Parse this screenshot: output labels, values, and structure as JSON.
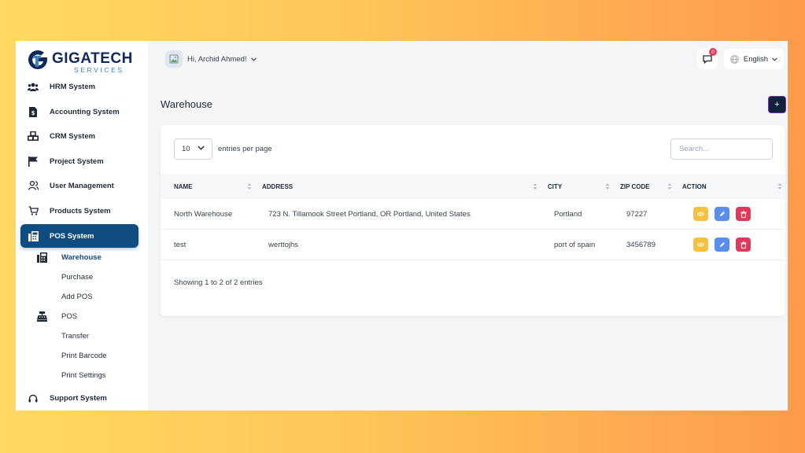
{
  "brand": {
    "name": "GIGATECH",
    "tagline": "SERVICES"
  },
  "sidebar": {
    "items": [
      {
        "label": "HRM System",
        "icon": "users-icon"
      },
      {
        "label": "Accounting System",
        "icon": "invoice-icon"
      },
      {
        "label": "CRM System",
        "icon": "cubes-icon"
      },
      {
        "label": "Project System",
        "icon": "flag-icon"
      },
      {
        "label": "User Management",
        "icon": "user-icon"
      },
      {
        "label": "Products System",
        "icon": "cart-icon"
      },
      {
        "label": "POS System",
        "icon": "fax-icon",
        "active": true
      }
    ],
    "pos_sub": [
      "Warehouse",
      "Purchase",
      "Add POS",
      "POS",
      "Transfer",
      "Print Barcode",
      "Print Settings"
    ],
    "support": "Support System"
  },
  "topbar": {
    "greeting": "Hi, Archid Ahmed!",
    "notification_count": "0",
    "language": "English"
  },
  "page": {
    "title": "Warehouse",
    "add_label": "+"
  },
  "table": {
    "length_value": "10",
    "length_label": "entries per page",
    "search_placeholder": "Search...",
    "columns": [
      "NAME",
      "ADDRESS",
      "CITY",
      "ZIP CODE",
      "ACTION"
    ],
    "rows": [
      {
        "name": "North Warehouse",
        "address": "723 N. Tillamook Street Portland, OR Portland, United States",
        "city": "Portland",
        "zip": "97227"
      },
      {
        "name": "test",
        "address": "werttojhs",
        "city": "port of spain",
        "zip": "3456789"
      }
    ],
    "showing": "Showing 1 to 2 of 2 entries"
  },
  "colors": {
    "primary": "#0f4c81",
    "view": "#f6c23e",
    "edit": "#5b8def",
    "delete": "#e0395a"
  }
}
